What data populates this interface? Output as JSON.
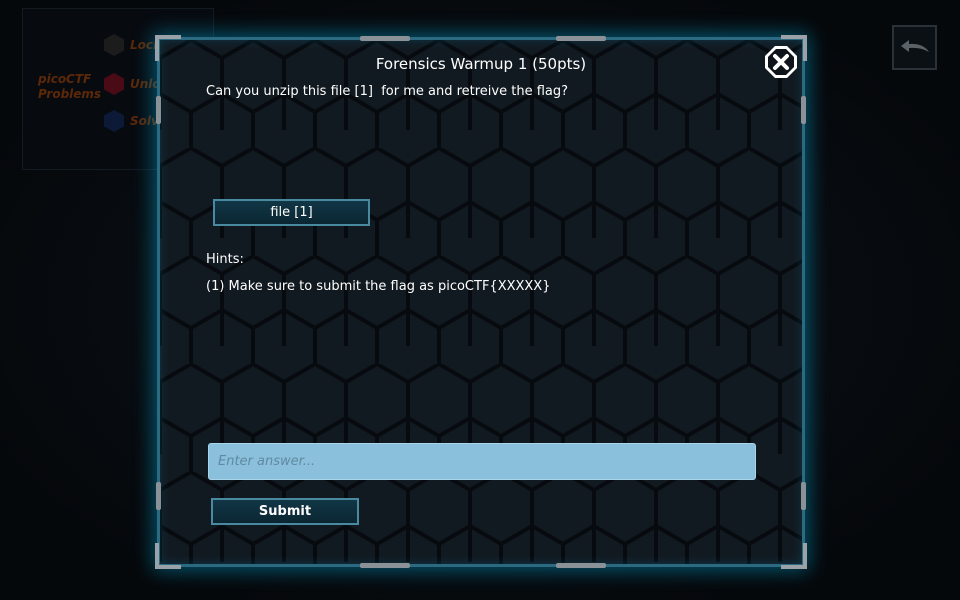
{
  "background": {
    "legend_title": "picoCTF Problems",
    "legend_items": [
      {
        "label": "Locked",
        "icon": "locked-hex-icon"
      },
      {
        "label": "Unlocked",
        "icon": "unlocked-hex-icon"
      },
      {
        "label": "Solved",
        "icon": "solved-hex-icon"
      }
    ],
    "back_icon": "back-arrow-icon"
  },
  "modal": {
    "title": "Forensics Warmup 1 (50pts)",
    "question": "Can you unzip this file [1]  for me and retreive the flag?",
    "file_button_label": "file [1]",
    "hints_label": "Hints:",
    "hints": [
      "(1) Make sure to submit the flag as picoCTF{XXXXX}"
    ],
    "answer_placeholder": "Enter answer...",
    "answer_value": "",
    "submit_label": "Submit",
    "close_icon": "close-icon"
  },
  "colors": {
    "accent_glow": "#00aadc",
    "input_bg": "#8bc0dd",
    "legend_text": "#5c2808"
  }
}
